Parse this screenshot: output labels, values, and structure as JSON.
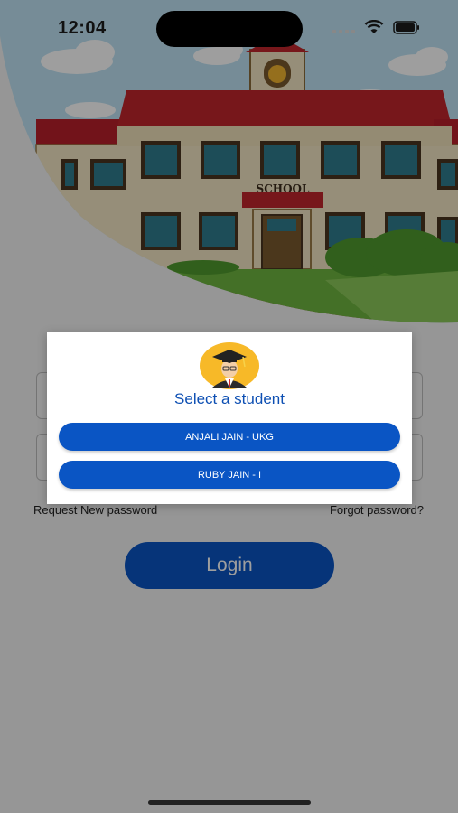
{
  "status_bar": {
    "time": "12:04",
    "icons": [
      "signal-icon",
      "wifi-icon",
      "battery-icon"
    ]
  },
  "hero": {
    "sign_text": "SCHOOL"
  },
  "login_form": {
    "request_link": "Request New password",
    "forgot_link": "Forgot password?",
    "login_label": "Login"
  },
  "dialog": {
    "avatar_icon": "graduate-avatar-icon",
    "title": "Select a student",
    "students": [
      {
        "label": "ANJALI JAIN - UKG"
      },
      {
        "label": "RUBY JAIN - I"
      }
    ]
  },
  "colors": {
    "primary": "#0a55c4",
    "title_blue": "#0d4fb3",
    "avatar_bg": "#f7b928"
  }
}
